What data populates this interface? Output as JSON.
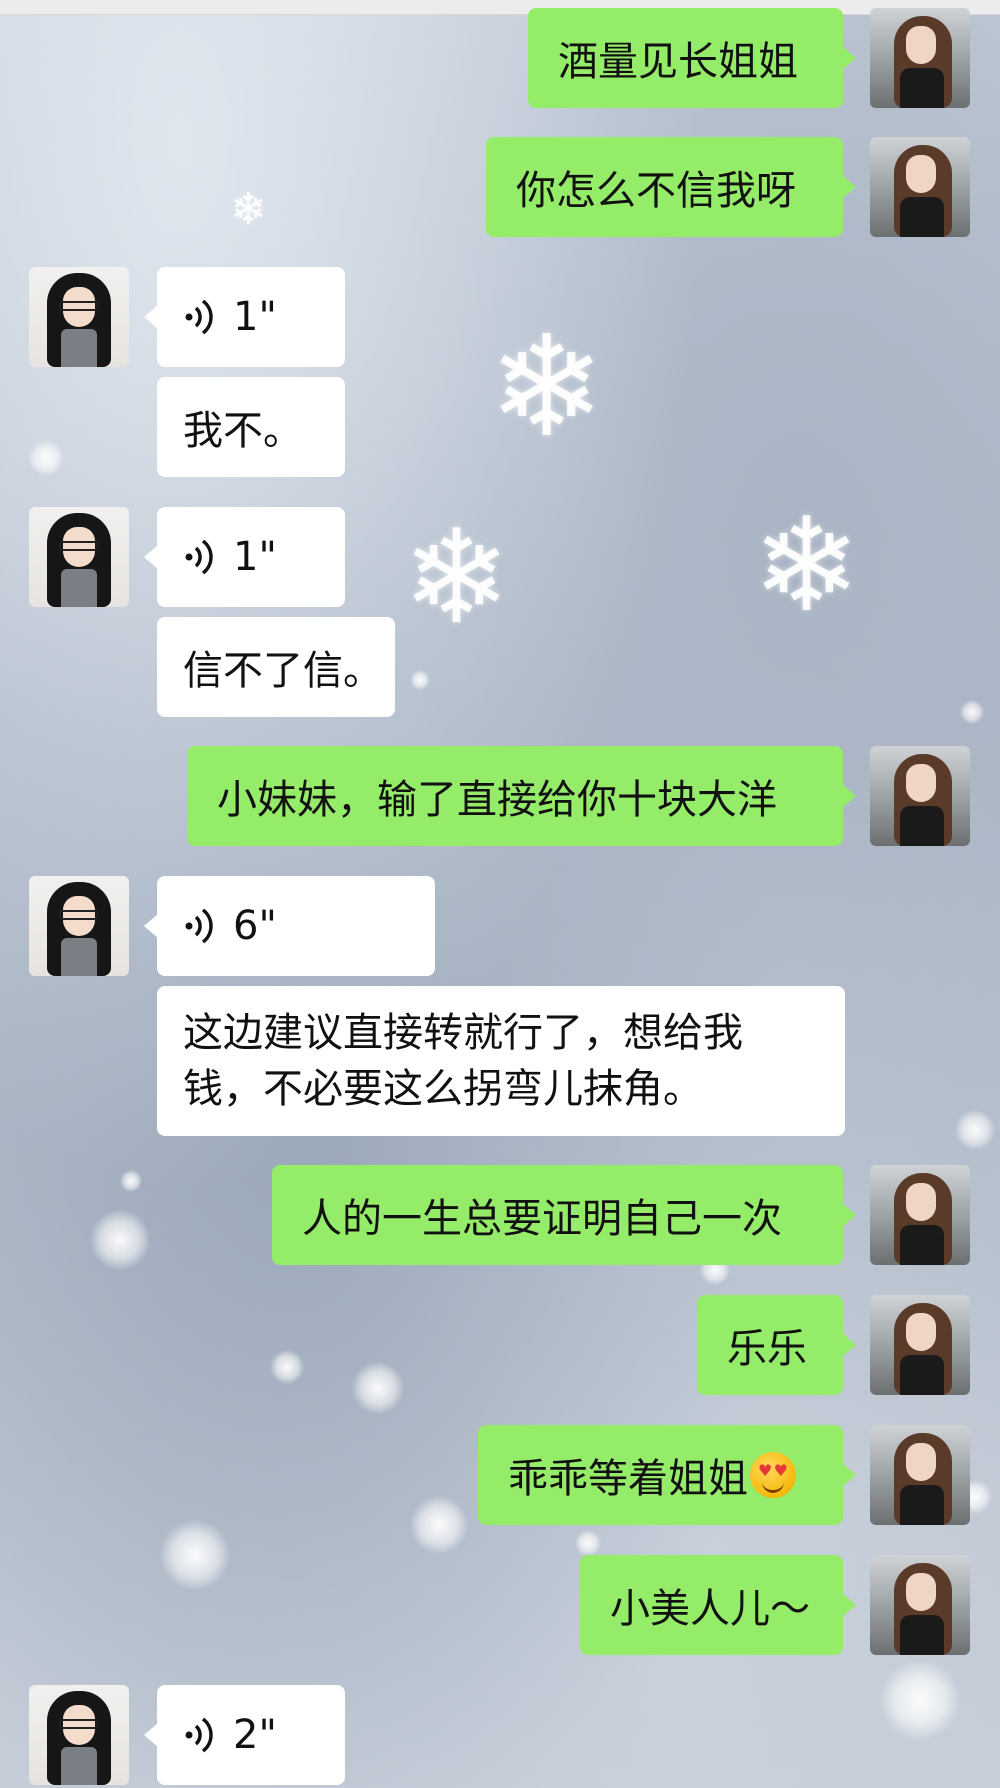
{
  "colors": {
    "incoming_bubble": "#ffffff",
    "outgoing_bubble": "#95ec69",
    "text": "#111111"
  },
  "messages": [
    {
      "side": "out",
      "type": "text",
      "text": "酒量见长姐姐"
    },
    {
      "side": "out",
      "type": "text",
      "text": "你怎么不信我呀"
    },
    {
      "side": "in",
      "type": "voice",
      "duration": "1\""
    },
    {
      "side": "in",
      "type": "text",
      "text": "我不。"
    },
    {
      "side": "in",
      "type": "voice",
      "duration": "1\""
    },
    {
      "side": "in",
      "type": "text",
      "text": "信不了信。"
    },
    {
      "side": "out",
      "type": "text",
      "text": "小妹妹，输了直接给你十块大洋"
    },
    {
      "side": "in",
      "type": "voice",
      "duration": "6\""
    },
    {
      "side": "in",
      "type": "text",
      "text": "这边建议直接转就行了，想给我钱，不必要这么拐弯儿抹角。"
    },
    {
      "side": "out",
      "type": "text",
      "text": "人的一生总要证明自己一次"
    },
    {
      "side": "out",
      "type": "text",
      "text": "乐乐"
    },
    {
      "side": "out",
      "type": "text",
      "text": "乖乖等着姐姐",
      "emoji": "smiling-face-with-heart-eyes"
    },
    {
      "side": "out",
      "type": "text",
      "text": "小美人儿～"
    },
    {
      "side": "in",
      "type": "voice",
      "duration": "2\""
    }
  ]
}
